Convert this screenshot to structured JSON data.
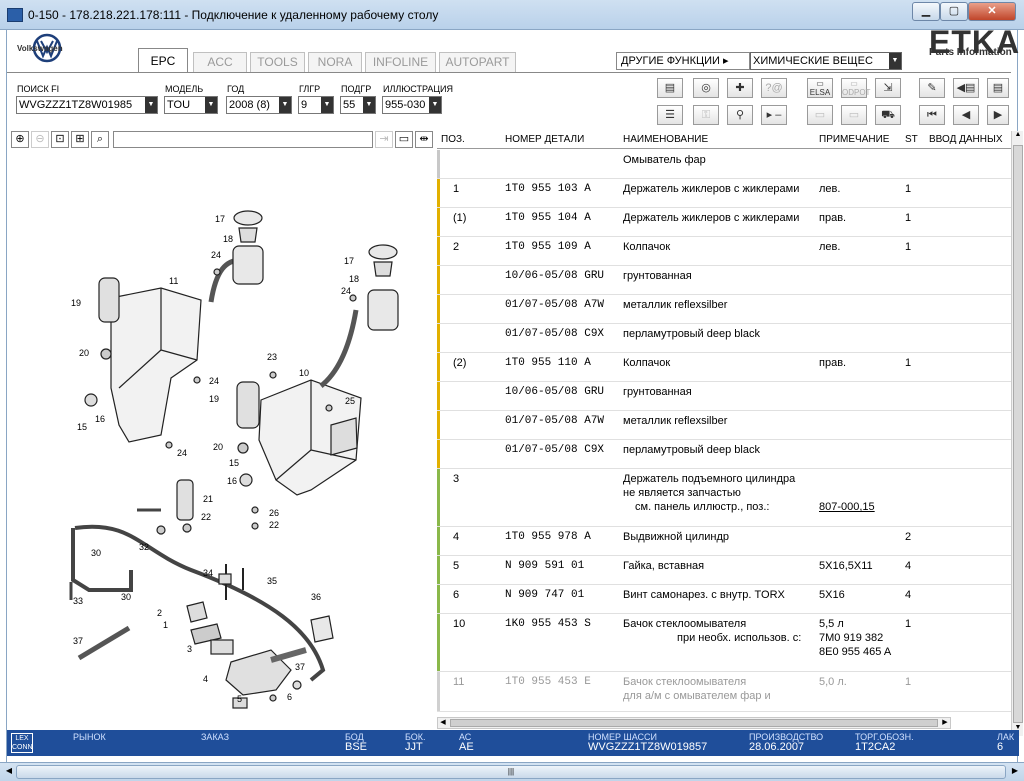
{
  "window": {
    "title": "0-150 - 178.218.221.178:111 - Подключение к удаленному рабочему столу"
  },
  "brand": {
    "logo_text": "Volkswagen",
    "app_name": "ETKA",
    "app_sub": "Parts Information"
  },
  "tabs": [
    {
      "label": "EPC"
    },
    {
      "label": "ACC"
    },
    {
      "label": "TOOLS"
    },
    {
      "label": "NORA"
    },
    {
      "label": "INFOLINE"
    },
    {
      "label": "AUTOPART"
    }
  ],
  "functions": {
    "other_label": "ДРУГИЕ ФУНКЦИИ",
    "chem_value": "ХИМИЧЕСКИЕ ВЕЩЕС"
  },
  "filters": [
    {
      "label": "ПОИСК FI",
      "value": "WVGZZZ1TZ8W01985"
    },
    {
      "label": "МОДЕЛЬ",
      "value": "TOU"
    },
    {
      "label": "ГОД",
      "value": "2008 (8)"
    },
    {
      "label": "ГЛГР",
      "value": "9"
    },
    {
      "label": "ПОДГР",
      "value": "55"
    },
    {
      "label": "ИЛЛЮСТРАЦИЯ",
      "value": "955-030"
    }
  ],
  "toolbar": {
    "elsa_label": "ELSA",
    "ooppc_label": "ODPOT"
  },
  "grid": {
    "columns": {
      "pos": "ПОЗ.",
      "part": "НОМЕР ДЕТАЛИ",
      "name": "НАИМЕНОВАНИЕ",
      "note": "ПРИМЕЧАНИЕ",
      "st": "ST",
      "input": "ВВОД ДАННЫХ"
    },
    "rows": [
      {
        "bar": "#c8c8c8",
        "pos": "",
        "part": "",
        "name": "Омыватель фар",
        "name2": "",
        "name3": "",
        "note": "",
        "note2": "",
        "note3": "",
        "st": "",
        "h": 29
      },
      {
        "bar": "#e2b000",
        "pos": "1",
        "part": "1T0 955 103 A",
        "name": "Держатель жиклеров с жиклерами",
        "name2": "",
        "name3": "",
        "note": "лев.",
        "note2": "",
        "note3": "",
        "st": "1",
        "h": 29
      },
      {
        "bar": "#e2b000",
        "pos": "(1)",
        "part": "1T0 955 104 A",
        "name": "Держатель жиклеров с жиклерами",
        "name2": "",
        "name3": "",
        "note": "прав.",
        "note2": "",
        "note3": "",
        "st": "1",
        "h": 29
      },
      {
        "bar": "#e2b000",
        "pos": "2",
        "part": "1T0 955 109 A",
        "name": "Колпачок",
        "name2": "",
        "name3": "",
        "note": "лев.",
        "note2": "",
        "note3": "",
        "st": "1",
        "h": 29
      },
      {
        "bar": "#e2b000",
        "pos": "",
        "part": "10/06-05/08 GRU",
        "name": "грунтованная",
        "name2": "",
        "name3": "",
        "note": "",
        "note2": "",
        "note3": "",
        "st": "",
        "h": 29
      },
      {
        "bar": "#e2b000",
        "pos": "",
        "part": "01/07-05/08 A7W",
        "name": "металлик reflexsilber",
        "name2": "",
        "name3": "",
        "note": "",
        "note2": "",
        "note3": "",
        "st": "",
        "h": 29
      },
      {
        "bar": "#e2b000",
        "pos": "",
        "part": "01/07-05/08 C9X",
        "name": "перламутровый deep black",
        "name2": "",
        "name3": "",
        "note": "",
        "note2": "",
        "note3": "",
        "st": "",
        "h": 29
      },
      {
        "bar": "#e2b000",
        "pos": "(2)",
        "part": "1T0 955 110 A",
        "name": "Колпачок",
        "name2": "",
        "name3": "",
        "note": "прав.",
        "note2": "",
        "note3": "",
        "st": "1",
        "h": 29
      },
      {
        "bar": "#e2b000",
        "pos": "",
        "part": "10/06-05/08 GRU",
        "name": "грунтованная",
        "name2": "",
        "name3": "",
        "note": "",
        "note2": "",
        "note3": "",
        "st": "",
        "h": 29
      },
      {
        "bar": "#e2b000",
        "pos": "",
        "part": "01/07-05/08 A7W",
        "name": "металлик reflexsilber",
        "name2": "",
        "name3": "",
        "note": "",
        "note2": "",
        "note3": "",
        "st": "",
        "h": 29
      },
      {
        "bar": "#e2b000",
        "pos": "",
        "part": "01/07-05/08 C9X",
        "name": "перламутровый deep black",
        "name2": "",
        "name3": "",
        "note": "",
        "note2": "",
        "note3": "",
        "st": "",
        "h": 29
      },
      {
        "bar": "#8ab84a",
        "pos": "3",
        "part": "",
        "name": "Держатель подъемного цилиндра",
        "name2": "не является запчастью",
        "name3": "см. панель иллюстр., поз.:",
        "note": "",
        "note2": "",
        "note3": "807-000,15",
        "st": "",
        "h": 58
      },
      {
        "bar": "#8ab84a",
        "pos": "4",
        "part": "1T0 955 978 A",
        "name": "Выдвижной цилиндр",
        "name2": "",
        "name3": "",
        "note": "",
        "note2": "",
        "note3": "",
        "st": "2",
        "h": 29
      },
      {
        "bar": "#8ab84a",
        "pos": "5",
        "part": "N 909 591 01",
        "name": "Гайка, вставная",
        "name2": "",
        "name3": "",
        "note": "5X16,5X11",
        "note2": "",
        "note3": "",
        "st": "4",
        "h": 29
      },
      {
        "bar": "#8ab84a",
        "pos": "6",
        "part": "N 909 747 01",
        "name": "Винт самонарез. с внутр. TORX",
        "name2": "",
        "name3": "",
        "note": "5X16",
        "note2": "",
        "note3": "",
        "st": "4",
        "h": 29
      },
      {
        "bar": "#8ab84a",
        "pos": "10",
        "part": "1K0 955 453 S",
        "name": "Бачок стеклоомывателя",
        "name2": "при необх. использов. с:",
        "name3": "",
        "note": "5,5 л",
        "note2": "7M0 919 382",
        "note3": "8E0 955 465 A",
        "st": "1",
        "h": 58
      },
      {
        "bar": "#d0d0d0",
        "pos": "11",
        "part": "1T0 955 453 E",
        "name": "Бачок стеклоомывателя",
        "name2": "для а/м с омывателем фар и",
        "name3": "",
        "note": "5,0 л.",
        "note2": "",
        "note3": "",
        "st": "1",
        "h": 40,
        "faded": true
      }
    ]
  },
  "status": [
    {
      "label": "",
      "value": ""
    },
    {
      "label": "РЫНОК",
      "value": ""
    },
    {
      "label": "ЗАКАЗ",
      "value": ""
    },
    {
      "label": "БОД",
      "value": "BSE"
    },
    {
      "label": "БОК.",
      "value": "JJT"
    },
    {
      "label": "АС",
      "value": "AE"
    },
    {
      "label": "НОМЕР ШАССИ",
      "value": "WVGZZZ1TZ8W019857"
    },
    {
      "label": "ПРОИЗВОДСТВО",
      "value": "28.06.2007"
    },
    {
      "label": "ТОРГ.ОБОЗН.",
      "value": "1T2CA2"
    },
    {
      "label": "ЛАК",
      "value": "6"
    }
  ],
  "status_logo": "LEX CONN",
  "diagram_labels": [
    "17",
    "18",
    "24",
    "11",
    "19",
    "20",
    "24",
    "16",
    "15",
    "24",
    "23",
    "10",
    "25",
    "19",
    "20",
    "15",
    "16",
    "17",
    "18",
    "24",
    "21",
    "22",
    "26",
    "22",
    "32",
    "34",
    "35",
    "30",
    "33",
    "30",
    "36",
    "2",
    "1",
    "37",
    "3",
    "4",
    "5",
    "6",
    "37"
  ]
}
